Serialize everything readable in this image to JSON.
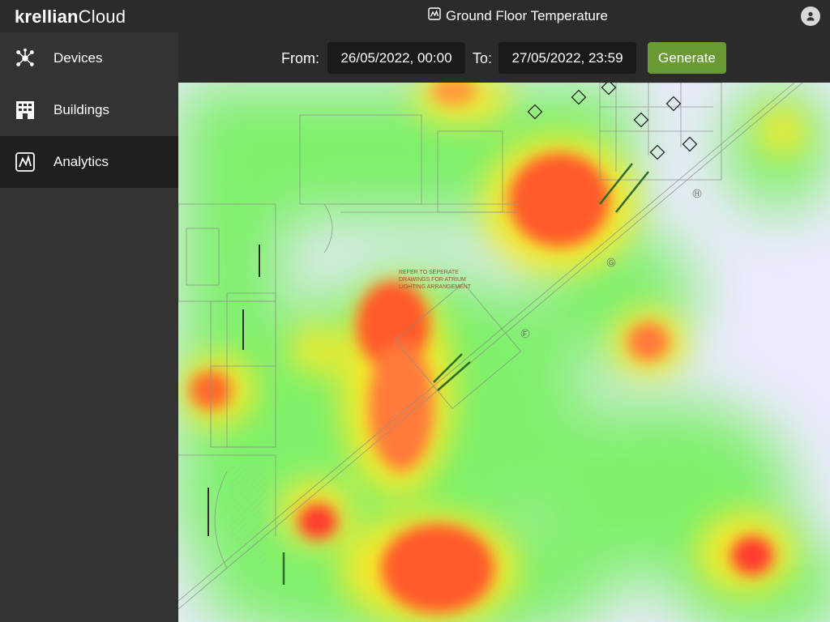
{
  "brand": {
    "bold": "krellian",
    "regular": "Cloud"
  },
  "header": {
    "title": "Ground Floor Temperature",
    "title_icon": "analytics-icon",
    "user_icon": "user-icon"
  },
  "sidebar": {
    "items": [
      {
        "label": "Devices",
        "icon": "devices-icon",
        "active": false
      },
      {
        "label": "Buildings",
        "icon": "building-icon",
        "active": false
      },
      {
        "label": "Analytics",
        "icon": "analytics-icon",
        "active": true
      }
    ]
  },
  "controls": {
    "from_label": "From:",
    "from_value": "26/05/2022, 00:00",
    "to_label": "To:",
    "to_value": "27/05/2022, 23:59",
    "generate_label": "Generate",
    "accent": "#6a9a34"
  },
  "map": {
    "annotation": [
      "REFER TO SEPERATE",
      "DRAWINGS FOR ATRIUM",
      "LIGHTING ARRANGEMENT"
    ],
    "grid_labels": [
      "H",
      "G",
      "F"
    ],
    "heat_colors": [
      "#ff3a2e",
      "#f6e92a",
      "#7ef06a",
      "#d9d4ff"
    ]
  }
}
